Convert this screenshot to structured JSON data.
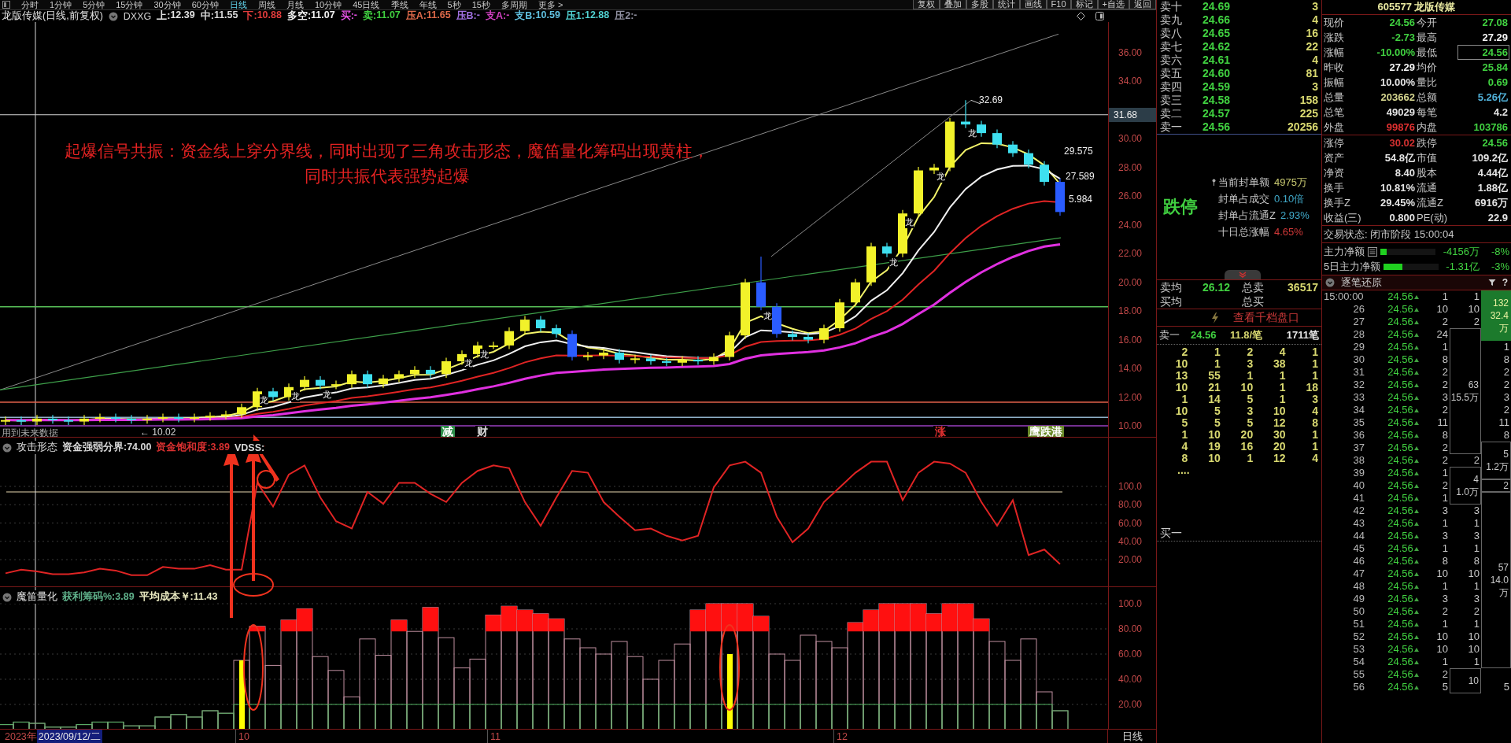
{
  "toolbar": {
    "periods": [
      {
        "label": "分时",
        "selected": false
      },
      {
        "label": "1分钟",
        "selected": false
      },
      {
        "label": "5分钟",
        "selected": false
      },
      {
        "label": "15分钟",
        "selected": false
      },
      {
        "label": "30分钟",
        "selected": false
      },
      {
        "label": "60分钟",
        "selected": false
      },
      {
        "label": "日线",
        "selected": true
      },
      {
        "label": "周线",
        "selected": false
      },
      {
        "label": "月线",
        "selected": false
      },
      {
        "label": "10分钟",
        "selected": false
      },
      {
        "label": "45日线",
        "selected": false
      },
      {
        "label": "季线",
        "selected": false
      },
      {
        "label": "年线",
        "selected": false
      },
      {
        "label": "5秒",
        "selected": false
      },
      {
        "label": "15秒",
        "selected": false
      },
      {
        "label": "多周期",
        "selected": false
      },
      {
        "label": "更多 >",
        "selected": false
      }
    ],
    "actions": [
      "复权",
      "叠加",
      "多股",
      "统计",
      "画线",
      "F10",
      "标记",
      "+自选",
      "返回"
    ]
  },
  "chart_header": {
    "title": "龙版传媒(日线,前复权)",
    "indicator": "DXXG",
    "items": [
      {
        "label": "上:",
        "value": "12.39",
        "color": "#e0e0e0"
      },
      {
        "label": "中:",
        "value": "11.55",
        "color": "#d8d8d8"
      },
      {
        "label": "下:",
        "value": "10.88",
        "color": "#e03c3c"
      },
      {
        "label": "多空:",
        "value": "11.07",
        "color": "#f0f0f0"
      },
      {
        "label": "买:",
        "value": "-",
        "color": "#e050e0"
      },
      {
        "label": "卖:",
        "value": "11.07",
        "color": "#40d040"
      },
      {
        "label": "压A:",
        "value": "11.65",
        "color": "#e06a4a"
      },
      {
        "label": "压B:",
        "value": "-",
        "color": "#a070e0"
      },
      {
        "label": "支A:",
        "value": "-",
        "color": "#d040c0"
      },
      {
        "label": "支B:",
        "value": "10.59",
        "color": "#60c0e0"
      },
      {
        "label": "压1:",
        "value": "12.88",
        "color": "#50d0d0"
      },
      {
        "label": "压2:",
        "value": "-",
        "color": "#9090a0"
      }
    ]
  },
  "main_chart": {
    "price_axis": [
      "36.00",
      "34.00",
      "30.00",
      "28.00",
      "26.00",
      "24.00",
      "22.00",
      "20.00",
      "18.00",
      "16.00",
      "14.00",
      "12.00",
      "10.00"
    ],
    "price_tag": "31.68",
    "value_labels": [
      "32.69",
      "29.575",
      "27.589",
      "5.984"
    ],
    "low_label": "← 10.02",
    "future_note": "用到未来数据",
    "annotation": [
      "起爆信号共振：资金线上穿分界线，同时出现了三角攻击形态，魔笛量化筹码出现黄柱，",
      "同时共振代表强势起爆"
    ],
    "dragon_marks": [
      "龙",
      "龙",
      "龙",
      "龙",
      "龙",
      "龙",
      "龙",
      "龙",
      "龙",
      "龙"
    ],
    "event_marks": [
      {
        "text": "减",
        "kind": "tag",
        "color": "#2e8e4a"
      },
      {
        "text": "财",
        "kind": "text",
        "color": "#d8d8d8"
      },
      {
        "text": "涨",
        "kind": "text",
        "color": "#e03030"
      },
      {
        "text": "鹰跌港",
        "kind": "tag",
        "color": "#6a8a2a"
      }
    ]
  },
  "attack_panel": {
    "title": "攻击形态",
    "items": [
      {
        "label": "资金强弱分界:",
        "value": "74.00",
        "color": "#d8d8d8"
      },
      {
        "label": "资金饱和度:",
        "value": "3.89",
        "color": "#d83030"
      },
      {
        "label": "VDSS:",
        "color": "#d8d8d8"
      }
    ],
    "axis_labels": [
      "100.0",
      "80.00",
      "60.00",
      "40.00",
      "20.00"
    ]
  },
  "chip_panel": {
    "title": "魔笛量化",
    "items": [
      {
        "label": "获利筹码%:",
        "value": "3.89",
        "color": "#5fb08a"
      },
      {
        "label": "平均成本￥:",
        "value": "11.43",
        "color": "#e8e8c0"
      }
    ],
    "axis_labels": [
      "100.0",
      "80.00",
      "60.00",
      "40.00",
      "20.00"
    ]
  },
  "date_axis": {
    "year": "2023年",
    "cursor_date": "2023/09/12/二",
    "months": [
      "10",
      "11",
      "12"
    ],
    "period": "日线"
  },
  "order_book": {
    "asks": [
      {
        "label": "卖十",
        "price": "24.69",
        "volume": "3"
      },
      {
        "label": "卖九",
        "price": "24.66",
        "volume": "4"
      },
      {
        "label": "卖八",
        "price": "24.65",
        "volume": "16"
      },
      {
        "label": "卖七",
        "price": "24.62",
        "volume": "22"
      },
      {
        "label": "卖六",
        "price": "24.61",
        "volume": "4"
      },
      {
        "label": "卖五",
        "price": "24.60",
        "volume": "81"
      },
      {
        "label": "卖四",
        "price": "24.59",
        "volume": "3"
      },
      {
        "label": "卖三",
        "price": "24.58",
        "volume": "158"
      },
      {
        "label": "卖二",
        "price": "24.57",
        "volume": "225"
      },
      {
        "label": "卖一",
        "price": "24.56",
        "volume": "20256"
      }
    ],
    "limit_state": "跌停",
    "limit_info": [
      {
        "label": "当前封单额",
        "value": "4975万",
        "color": "#c8c870"
      },
      {
        "label": "封单占成交",
        "value": "0.10倍",
        "color": "#40a8c8"
      },
      {
        "label": "封单占流通Z",
        "value": "2.93%",
        "color": "#40a8c8"
      },
      {
        "label": "十日总涨幅",
        "value": "4.65%",
        "color": "#d03838"
      }
    ],
    "averages": [
      {
        "label": "卖均",
        "value": "26.12",
        "label2": "总卖",
        "value2": "36517"
      },
      {
        "label": "买均",
        "label2": "总买"
      }
    ],
    "depth_link": "查看千档盘口",
    "best_ask": {
      "label": "卖一",
      "price": "24.56",
      "per_order": "11.8/笔",
      "orders": "1711笔"
    },
    "queue": [
      [
        "2",
        "1",
        "2",
        "4",
        "1"
      ],
      [
        "10",
        "1",
        "3",
        "38",
        "1"
      ],
      [
        "13",
        "55",
        "1",
        "1",
        "1"
      ],
      [
        "10",
        "21",
        "10",
        "1",
        "18"
      ],
      [
        "1",
        "14",
        "5",
        "1",
        "3"
      ],
      [
        "10",
        "5",
        "3",
        "10",
        "4"
      ],
      [
        "5",
        "5",
        "5",
        "12",
        "8"
      ],
      [
        "1",
        "10",
        "20",
        "30",
        "1"
      ],
      [
        "4",
        "19",
        "16",
        "20",
        "1"
      ],
      [
        "8",
        "10",
        "1",
        "12",
        "4"
      ]
    ],
    "queue_more": "....",
    "best_bid": "买一"
  },
  "quote": {
    "code": "605577",
    "name": "龙版传媒",
    "main": [
      {
        "label": "现价",
        "value": "24.56",
        "color": "#40d040",
        "boxed": false
      },
      {
        "label": "今开",
        "value": "27.08",
        "color": "#40d040",
        "boxed": false
      },
      {
        "label": "涨跌",
        "value": "-2.73",
        "color": "#40d040",
        "boxed": false
      },
      {
        "label": "最高",
        "value": "27.29",
        "color": "#f4f4f4",
        "boxed": false
      },
      {
        "label": "涨幅",
        "value": "-10.00%",
        "color": "#40d040",
        "boxed": false
      },
      {
        "label": "最低",
        "value": "24.56",
        "color": "#40d040",
        "boxed": true
      },
      {
        "label": "昨收",
        "value": "27.29",
        "color": "#f4f4f4",
        "boxed": false
      },
      {
        "label": "均价",
        "value": "25.84",
        "color": "#40d040",
        "boxed": false
      },
      {
        "label": "振幅",
        "value": "10.00%",
        "color": "#e4e4e4",
        "boxed": false
      },
      {
        "label": "量比",
        "value": "0.69",
        "color": "#40d040",
        "boxed": false
      },
      {
        "label": "总量",
        "value": "203662",
        "color": "#d8d890",
        "boxed": false
      },
      {
        "label": "总额",
        "value": "5.26亿",
        "color": "#50b0d8",
        "boxed": false
      },
      {
        "label": "总笔",
        "value": "49029",
        "color": "#e4e4e4",
        "boxed": false
      },
      {
        "label": "每笔",
        "value": "4.2",
        "color": "#e4e4e4",
        "boxed": false
      },
      {
        "label": "外盘",
        "value": "99876",
        "color": "#e03030",
        "boxed": false
      },
      {
        "label": "内盘",
        "value": "103786",
        "color": "#40d040",
        "boxed": false
      }
    ],
    "fundamentals": [
      {
        "label": "涨停",
        "value": "30.02",
        "color": "#d03030"
      },
      {
        "label": "跌停",
        "value": "24.56",
        "color": "#40d040"
      },
      {
        "label": "资产",
        "value": "54.8亿",
        "color": "#e4e4e4"
      },
      {
        "label": "市值",
        "value": "109.2亿",
        "color": "#e4e4e4"
      },
      {
        "label": "净资",
        "value": "8.40",
        "color": "#e4e4e4"
      },
      {
        "label": "股本",
        "value": "4.44亿",
        "color": "#e4e4e4"
      },
      {
        "label": "换手",
        "value": "10.81%",
        "color": "#e4e4e4"
      },
      {
        "label": "流通",
        "value": "1.88亿",
        "color": "#e4e4e4"
      },
      {
        "label": "换手Z",
        "value": "29.45%",
        "color": "#e4e4e4"
      },
      {
        "label": "流通Z",
        "value": "6916万",
        "color": "#e4e4e4"
      },
      {
        "label": "收益(三)",
        "value": "0.800",
        "color": "#e4e4e4"
      },
      {
        "label": "PE(动)",
        "value": "22.9",
        "color": "#e4e4e4"
      }
    ],
    "status": "交易状态: 闭市阶段 15:00:04",
    "fund_flow": [
      {
        "label": "主力净额",
        "detail_icon": true,
        "level": 0.11,
        "value": "-4156万",
        "pct": "-8%"
      },
      {
        "label": "5日主力净额",
        "detail_icon": false,
        "level": 0.34,
        "value": "-1.31亿",
        "pct": "-3%"
      }
    ]
  },
  "ticks": {
    "title": "逐笔还原",
    "help": "?",
    "rows": [
      {
        "time": "15:00:00",
        "price": "24.56",
        "volume": "1",
        "split": "1"
      },
      {
        "time": "26",
        "price": "24.56",
        "volume": "10",
        "split": "10"
      },
      {
        "time": "27",
        "price": "24.56",
        "volume": "2",
        "split": "2"
      },
      {
        "time": "28",
        "price": "24.56",
        "volume": "24"
      },
      {
        "time": "29",
        "price": "24.56",
        "volume": "1",
        "net": "1"
      },
      {
        "time": "30",
        "price": "24.56",
        "volume": "8",
        "net": "8"
      },
      {
        "time": "31",
        "price": "24.56",
        "volume": "2",
        "net": "2"
      },
      {
        "time": "32",
        "price": "24.56",
        "volume": "2",
        "net": "2"
      },
      {
        "time": "33",
        "price": "24.56",
        "volume": "3",
        "net": "3"
      },
      {
        "time": "34",
        "price": "24.56",
        "volume": "2",
        "net": "2"
      },
      {
        "time": "35",
        "price": "24.56",
        "volume": "11",
        "net": "11"
      },
      {
        "time": "36",
        "price": "24.56",
        "volume": "8",
        "net": "8"
      },
      {
        "time": "37",
        "price": "24.56",
        "volume": "2"
      },
      {
        "time": "38",
        "price": "24.56",
        "volume": "2",
        "split": "2"
      },
      {
        "time": "39",
        "price": "24.56",
        "volume": "1"
      },
      {
        "time": "40",
        "price": "24.56",
        "volume": "2"
      },
      {
        "time": "41",
        "price": "24.56",
        "volume": "1"
      },
      {
        "time": "42",
        "price": "24.56",
        "volume": "3",
        "split": "3"
      },
      {
        "time": "43",
        "price": "24.56",
        "volume": "1",
        "split": "1"
      },
      {
        "time": "44",
        "price": "24.56",
        "volume": "3",
        "split": "3"
      },
      {
        "time": "45",
        "price": "24.56",
        "volume": "1",
        "split": "1"
      },
      {
        "time": "46",
        "price": "24.56",
        "volume": "8",
        "split": "8"
      },
      {
        "time": "47",
        "price": "24.56",
        "volume": "10",
        "split": "10"
      },
      {
        "time": "48",
        "price": "24.56",
        "volume": "1",
        "split": "1"
      },
      {
        "time": "49",
        "price": "24.56",
        "volume": "3",
        "split": "3"
      },
      {
        "time": "50",
        "price": "24.56",
        "volume": "2",
        "split": "2"
      },
      {
        "time": "51",
        "price": "24.56",
        "volume": "1",
        "split": "1"
      },
      {
        "time": "52",
        "price": "24.56",
        "volume": "10",
        "split": "10"
      },
      {
        "time": "53",
        "price": "24.56",
        "volume": "10",
        "split": "10"
      },
      {
        "time": "54",
        "price": "24.56",
        "volume": "1",
        "split": "1"
      },
      {
        "time": "55",
        "price": "24.56",
        "volume": "2"
      },
      {
        "time": "56",
        "price": "24.56",
        "volume": "5",
        "net": "5"
      }
    ],
    "split_groups": [
      {
        "count": "63",
        "amount": "15.5万"
      },
      {
        "count": "4",
        "amount": "1.0万"
      },
      {
        "count": "10"
      }
    ],
    "net_groups": [
      {
        "count": "132",
        "amount": "32.4万",
        "highlighted": true
      },
      {
        "count": "5",
        "amount": "1.2万",
        "highlighted": false
      },
      {
        "count": "2",
        "highlighted": false
      },
      {
        "count": "57",
        "amount": "14.0万",
        "highlighted": false
      }
    ]
  }
}
